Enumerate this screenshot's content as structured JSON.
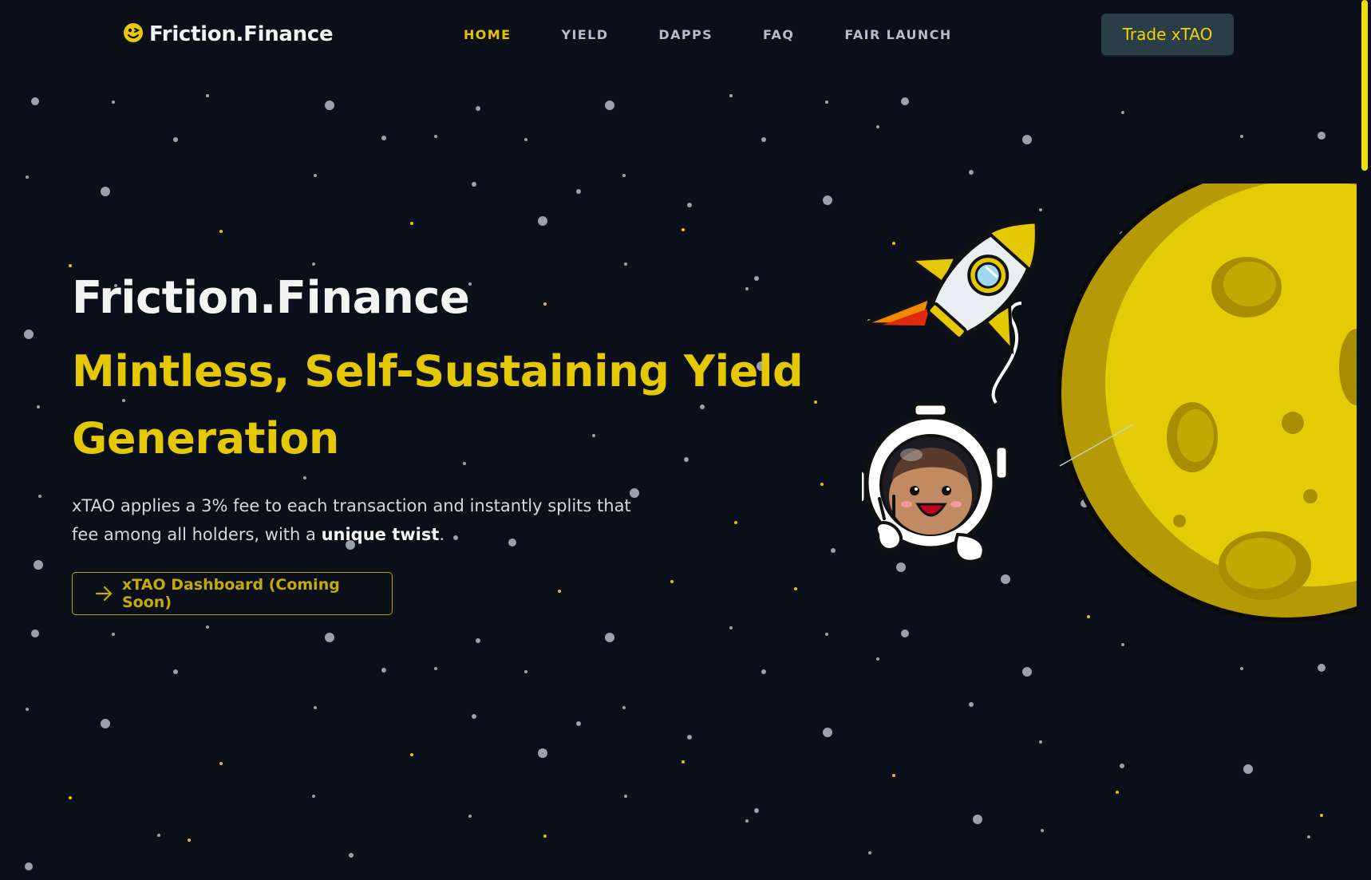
{
  "nav": {
    "logo_text": "Friction.Finance",
    "links": [
      {
        "label": "HOME",
        "active": true
      },
      {
        "label": "YIELD",
        "active": false
      },
      {
        "label": "DAPPS",
        "active": false
      },
      {
        "label": "FAQ",
        "active": false
      },
      {
        "label": "FAIR LAUNCH",
        "active": false
      }
    ],
    "cta_label": "Trade xTAO"
  },
  "hero": {
    "title": "Friction.Finance",
    "subtitle": "Mintless, Self-Sustaining Yield Generation",
    "description_prefix": "xTAO applies a 3% fee to each transaction and instantly splits that fee among all holders, with a ",
    "description_bold": "unique twist",
    "description_suffix": ".",
    "button_label": "xTAO Dashboard (Coming Soon)"
  },
  "icons": {
    "logo": "smiley-coin-icon",
    "button_arrow": "arrow-right-icon"
  },
  "colors": {
    "background": "#0b0f1a",
    "accent": "#e5c804",
    "cta_background": "#2b3d46"
  }
}
